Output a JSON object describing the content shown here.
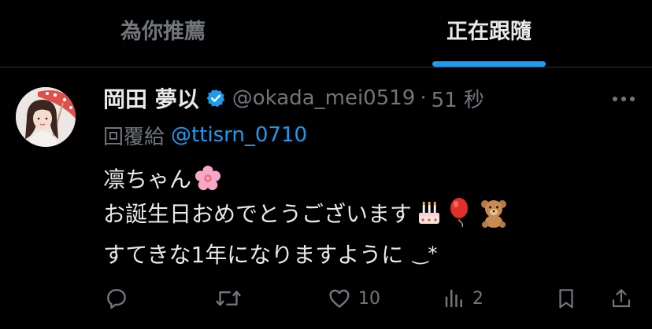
{
  "tabs": [
    {
      "label": "為你推薦",
      "active": false
    },
    {
      "label": "正在跟隨",
      "active": true
    }
  ],
  "tweet": {
    "display_name": "岡田 夢以",
    "verified": true,
    "handle": "@okada_mei0519",
    "separator": "·",
    "time": "51 秒",
    "reply_prefix": "回覆給",
    "reply_to": "@ttisrn_0710",
    "lines": [
      "凛ちゃん",
      "お誕生日おめでとうございます",
      "すてきな1年になりますように"
    ],
    "line3_kaomoji": "‿*",
    "emojis": [
      "cherry-blossom-icon",
      "birthday-cake-icon",
      "red-balloon-icon",
      "teddy-bear-icon"
    ],
    "actions": {
      "reply": {
        "icon": "reply-icon",
        "count": ""
      },
      "retweet": {
        "icon": "retweet-icon",
        "count": ""
      },
      "like": {
        "icon": "heart-icon",
        "count": "10"
      },
      "views": {
        "icon": "analytics-icon",
        "count": "2"
      },
      "bookmark": {
        "icon": "bookmark-icon"
      },
      "share": {
        "icon": "share-icon"
      }
    }
  },
  "colors": {
    "background": "#000000",
    "text_primary": "#e7e9ea",
    "text_secondary": "#71767b",
    "accent": "#1d9bf0",
    "divider": "#2f3336"
  }
}
